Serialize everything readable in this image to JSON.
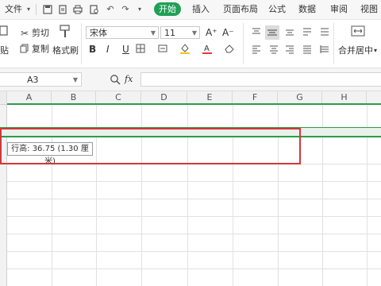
{
  "menubar": {
    "file_label": "文件",
    "tabs": [
      "开始",
      "插入",
      "页面布局",
      "公式",
      "数据",
      "审阅",
      "视图"
    ]
  },
  "ribbon": {
    "cut_label": "剪切",
    "paste_label": "贴",
    "copy_label": "复制",
    "format_painter_label": "格式刷",
    "font_name": "宋体",
    "font_size": "11",
    "grow_font": "A⁺",
    "shrink_font": "A⁻",
    "bold": "B",
    "italic": "I",
    "underline": "U",
    "merge_center_label": "合并居中"
  },
  "formula_bar": {
    "cell_ref": "A3",
    "fx": "fx"
  },
  "grid": {
    "columns": [
      "A",
      "B",
      "C",
      "D",
      "E",
      "F",
      "G",
      "H"
    ]
  },
  "tooltip": {
    "text": "行高: 36.75 (1.30 厘米)"
  },
  "colors": {
    "accent_green": "#1fa055",
    "selection_green": "#2e9b4c",
    "highlight_red": "#d2373c"
  }
}
